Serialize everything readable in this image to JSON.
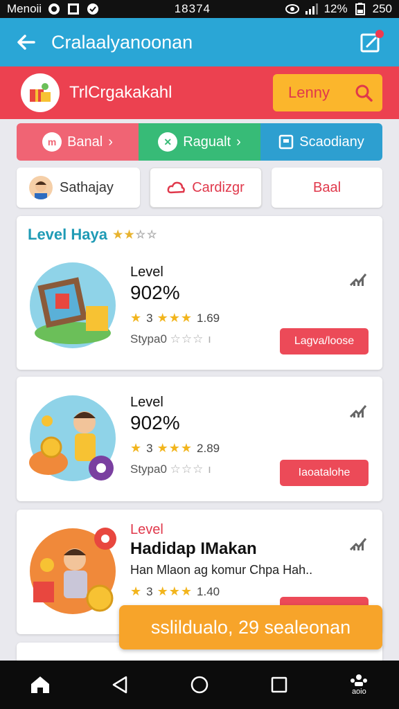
{
  "status_bar": {
    "carrier": "Menoii",
    "time": "18374",
    "battery": "12%",
    "right_text": "250"
  },
  "app_bar": {
    "title": "Cralaalyanoonan",
    "back_icon": "arrow-left-icon",
    "share_icon": "edit-share-icon"
  },
  "header": {
    "title": "TrlCrgakakahl",
    "button_label": "Lenny",
    "button_icon": "search-icon"
  },
  "tabs": [
    {
      "label": "Banal",
      "icon": "m-circle-icon",
      "arrow": "›"
    },
    {
      "label": "Ragualt",
      "icon": "x-circle-icon",
      "arrow": "›"
    },
    {
      "label": "Scaodiany",
      "icon": "square-icon",
      "arrow": ""
    }
  ],
  "chips": [
    {
      "label": "Sathajay",
      "icon": "avatar"
    },
    {
      "label": "Cardizgr",
      "icon": "cloud-icon"
    },
    {
      "label": "Baal"
    }
  ],
  "section": {
    "title": "Level Haya"
  },
  "items": [
    {
      "sub": "Level",
      "main": "902%",
      "rating_prefix": "3",
      "rating_value": "1.69",
      "meta": "Stypa0",
      "action": "Lagva/loose"
    },
    {
      "sub": "Level",
      "main": "902%",
      "rating_prefix": "3",
      "rating_value": "2.89",
      "meta": "Stypa0",
      "action": "Iaoatalohe"
    },
    {
      "sub": "Level",
      "main": "Hadidap IMakan",
      "desc": "Han Mlaon ag komur Chpa Hah..",
      "rating_prefix": "3",
      "rating_value": "1.40"
    }
  ],
  "toast": {
    "text": "sslildualo, 29 sealeonan"
  },
  "nav": {
    "home": "home-icon",
    "back": "triangle-back-icon",
    "home_circle": "circle-home-icon",
    "recent": "square-recent-icon",
    "more_label": "aoio"
  },
  "colors": {
    "app_bar": "#2aa6d6",
    "header": "#ec4150",
    "accent_yellow": "#fbb62c",
    "tab_pink": "#f06474",
    "tab_green": "#37bb77",
    "tab_blue": "#2d9fd0",
    "action_red": "#ec4a58",
    "toast": "#f7a42a"
  }
}
